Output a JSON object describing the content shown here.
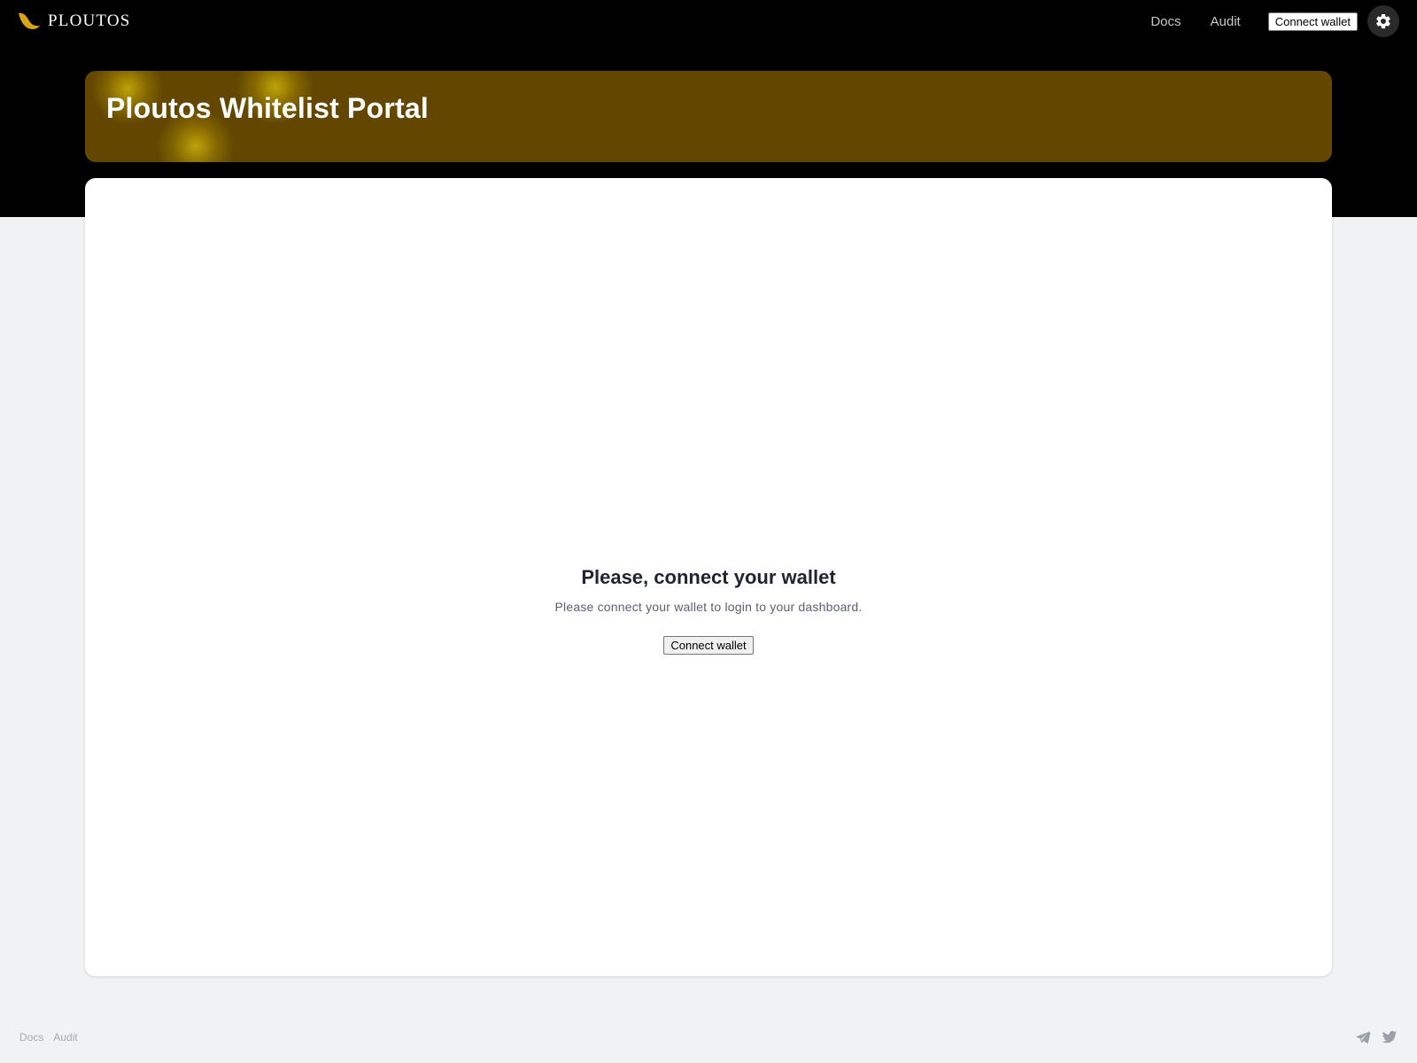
{
  "header": {
    "brand_name": "PLOUTOS",
    "nav_links": [
      "Docs",
      "Audit"
    ],
    "connect_label": "Connect wallet"
  },
  "banner": {
    "title": "Ploutos Whitelist Portal"
  },
  "main": {
    "heading": "Please, connect your wallet",
    "message": "Please connect your wallet to login to your dashboard.",
    "connect_label": "Connect wallet"
  },
  "footer": {
    "links": [
      "Docs",
      "Audit"
    ]
  },
  "icons": {
    "brand": "ploutos-logo-icon",
    "settings": "gear-icon",
    "social": [
      "telegram-icon",
      "twitter-icon"
    ]
  },
  "colors": {
    "header_bg": "#000000",
    "banner_bg": "#634700",
    "accent_gold": "#d8a317",
    "page_bg": "#f1f2f4"
  }
}
